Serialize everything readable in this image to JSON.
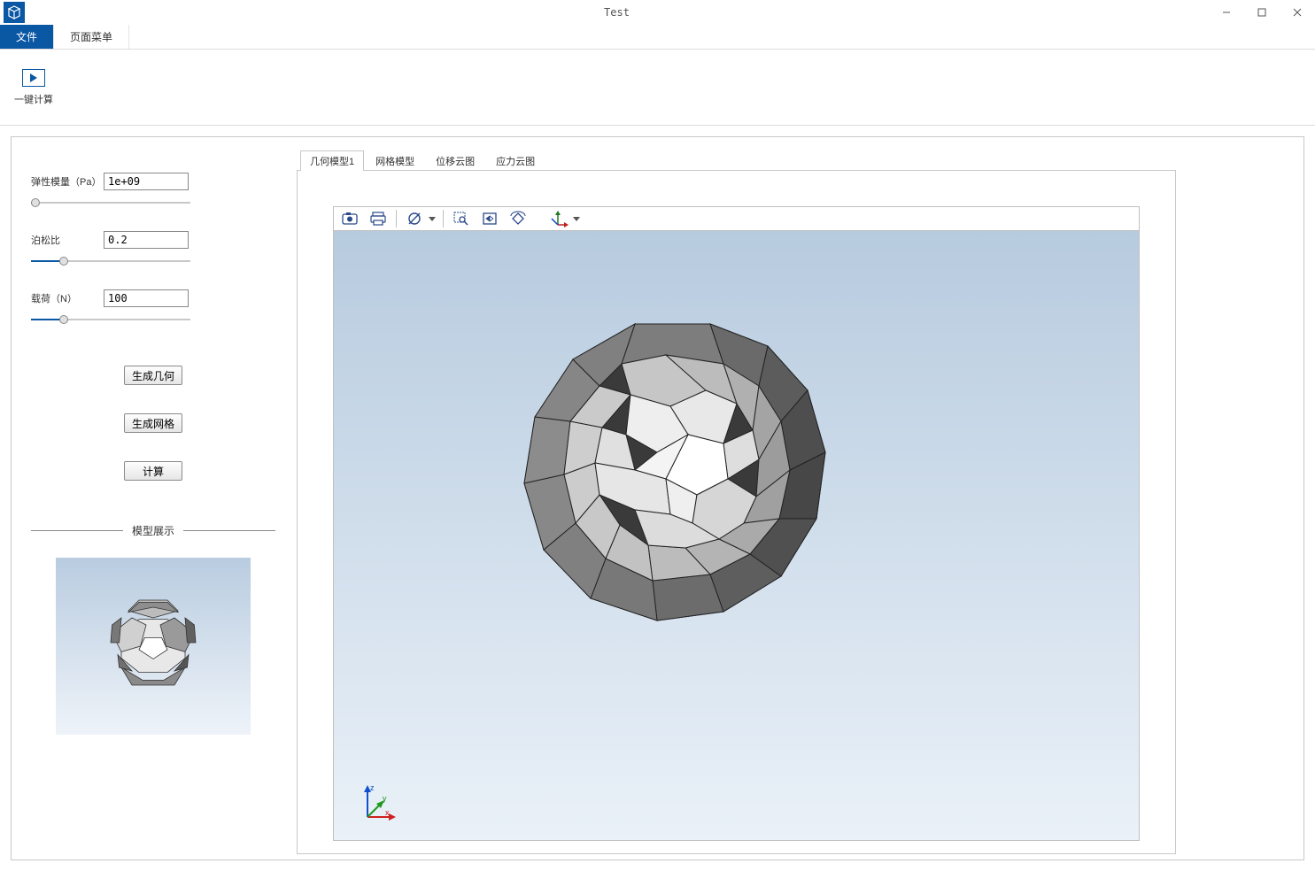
{
  "window": {
    "title": "Test"
  },
  "ribbon": {
    "file_tab": "文件",
    "page_tab": "页面菜单",
    "calc_label": "一键计算"
  },
  "form": {
    "elastic_label": "弹性模量（Pa）",
    "elastic_value": "1e+09",
    "poisson_label": "泊松比",
    "poisson_value": "0.2",
    "load_label": "载荷（N）",
    "load_value": "100"
  },
  "buttons": {
    "gen_geom": "生成几何",
    "gen_mesh": "生成网格",
    "compute": "计算"
  },
  "section": {
    "preview_title": "模型展示"
  },
  "view_tabs": {
    "geom": "几何模型1",
    "mesh": "网格模型",
    "disp": "位移云图",
    "stress": "应力云图"
  },
  "toolbar_icons": {
    "screenshot": "screenshot-icon",
    "print": "print-icon",
    "hide": "hide-icon",
    "zoom_region": "zoom-region-icon",
    "zoom_fit": "zoom-fit-icon",
    "rotate": "rotate-icon",
    "axes": "axes-icon"
  },
  "axis_labels": {
    "x": "x",
    "y": "y",
    "z": "z"
  }
}
